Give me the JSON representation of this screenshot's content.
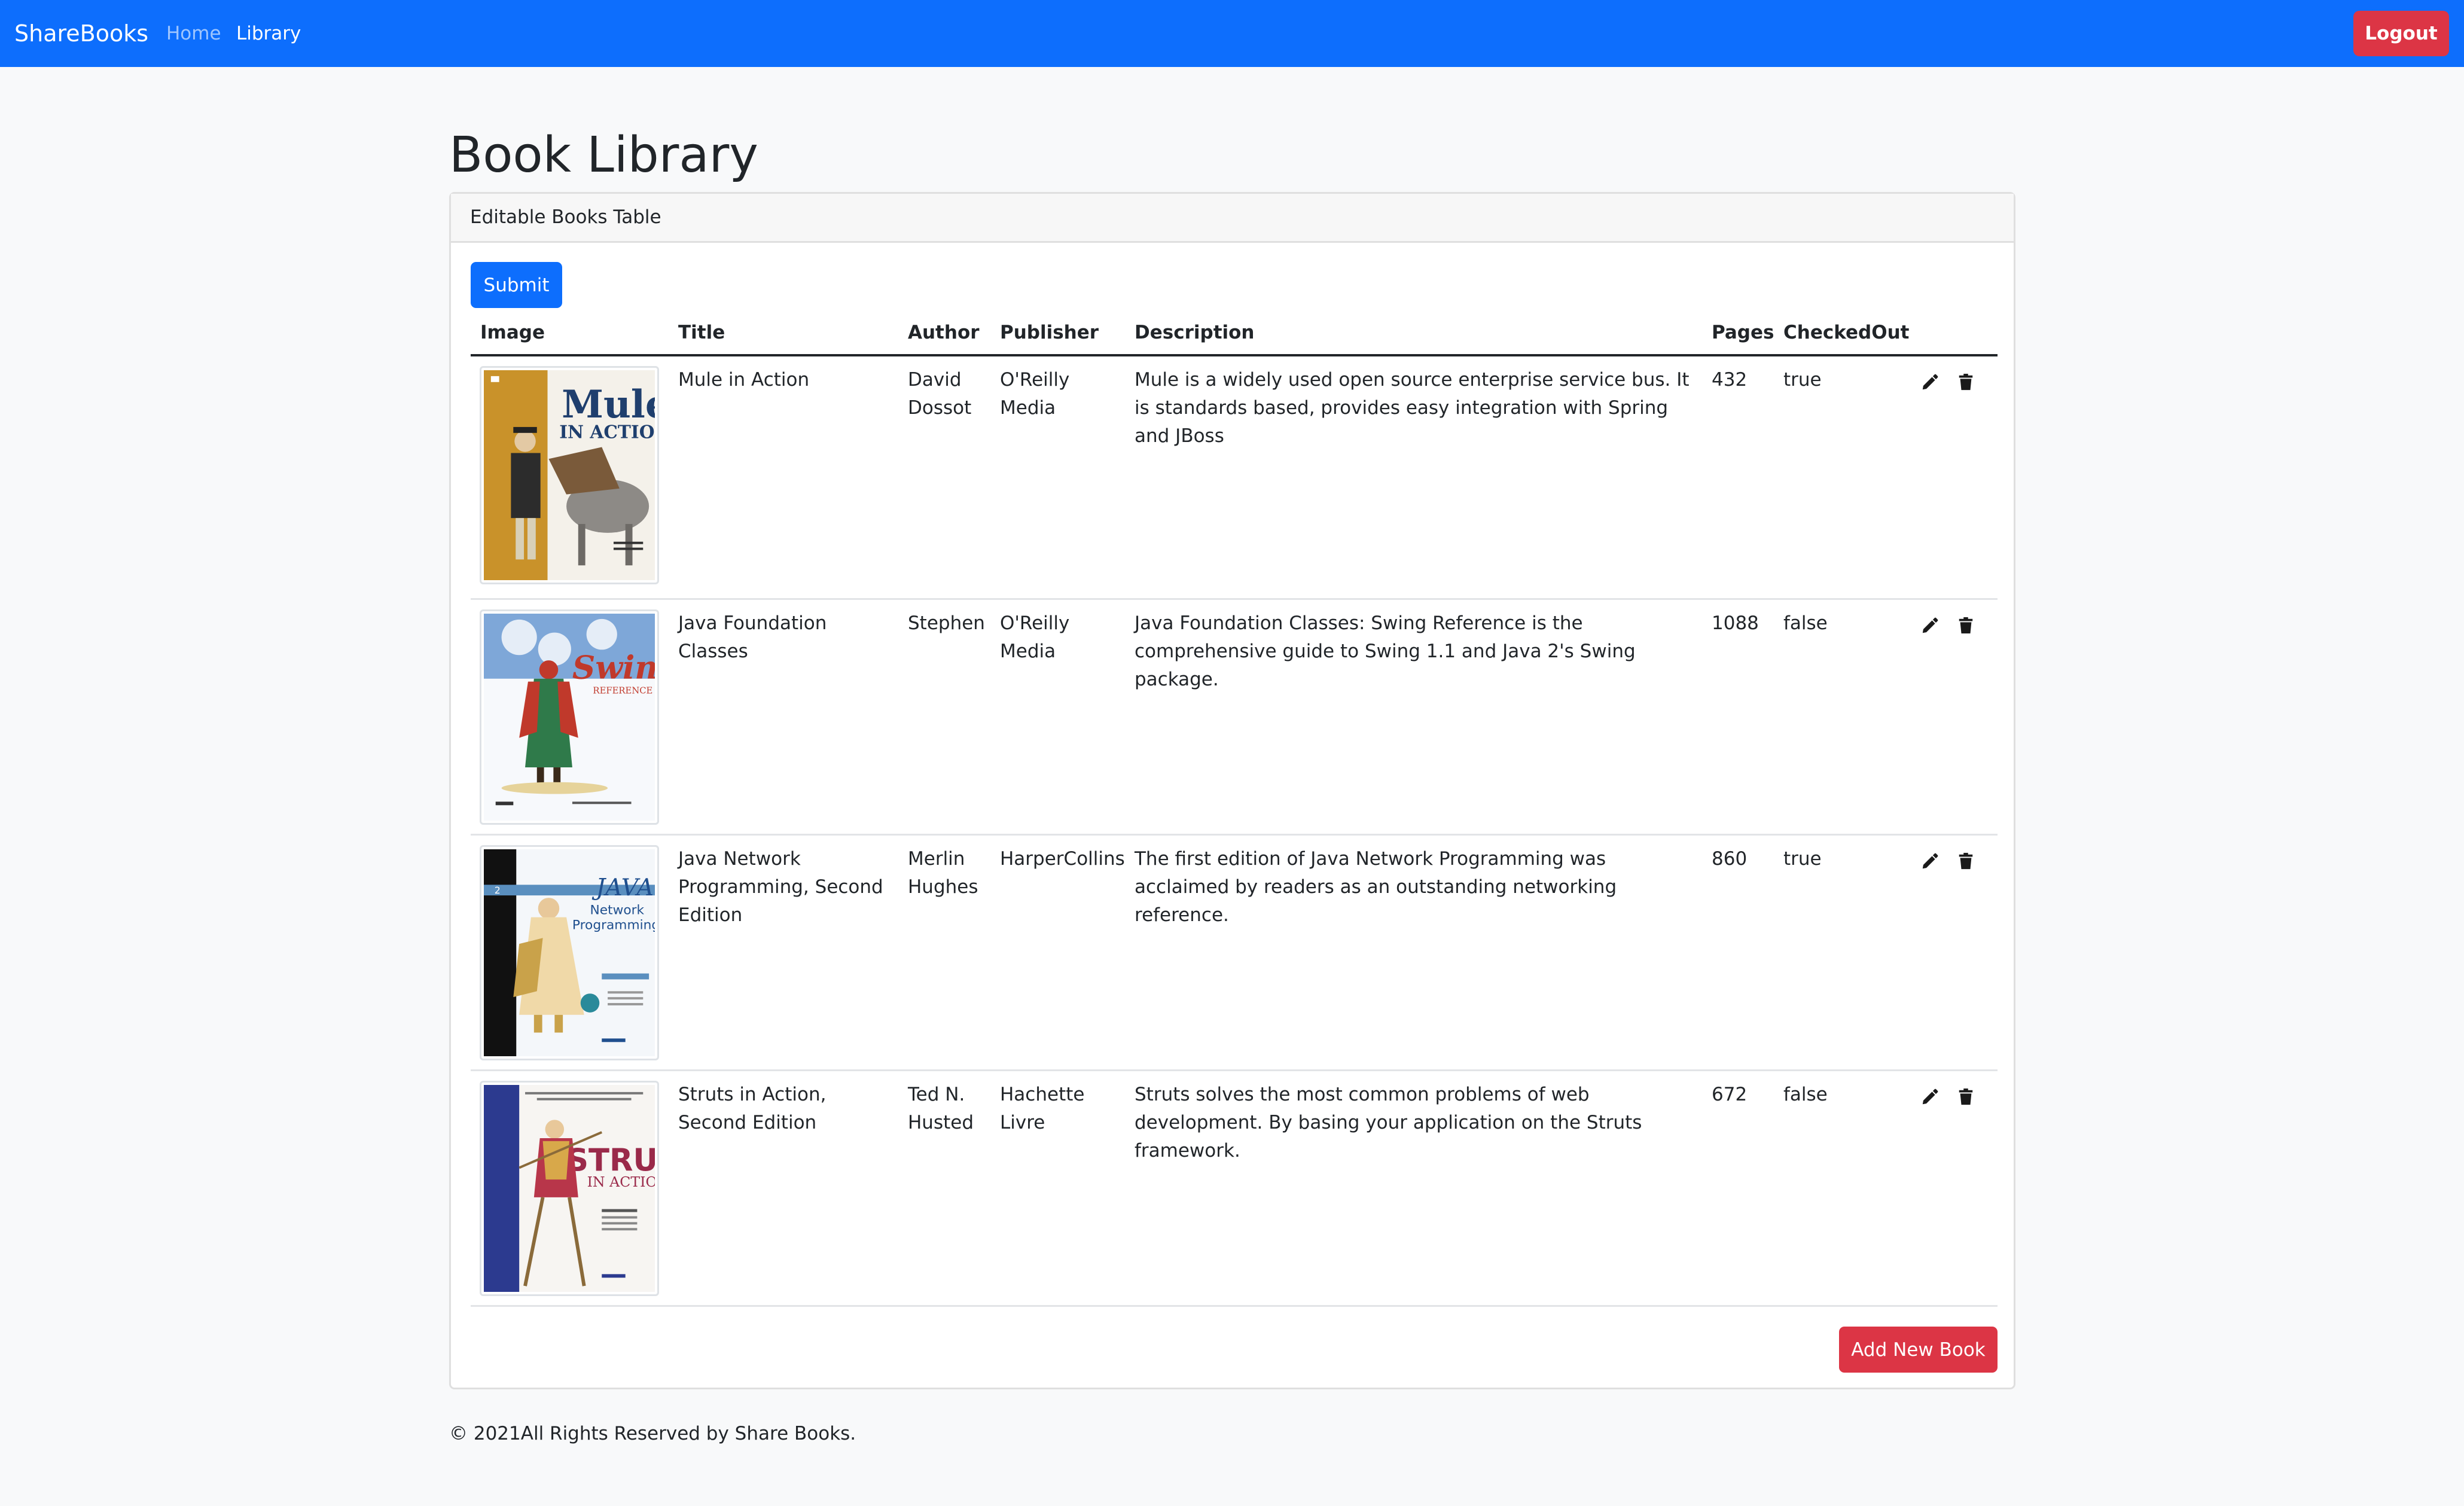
{
  "navbar": {
    "brand": "ShareBooks",
    "links": [
      {
        "label": "Home"
      },
      {
        "label": "Library"
      }
    ],
    "logout_label": "Logout",
    "bg_color": "#0d6efd"
  },
  "page": {
    "title": "Book Library"
  },
  "card": {
    "header": "Editable Books Table",
    "submit_label": "Submit",
    "add_label": "Add New Book"
  },
  "table": {
    "columns": [
      "Image",
      "Title",
      "Author",
      "Publisher",
      "Description",
      "Pages",
      "CheckedOut"
    ],
    "rows": [
      {
        "title": "Mule in Action",
        "author": "David Dossot",
        "publisher": "O'Reilly Media",
        "description": "Mule is a widely used open source enterprise service bus. It is standards based, provides easy integration with Spring and JBoss",
        "pages": "432",
        "checked_out": "true",
        "cover": {
          "line1": "Mule",
          "line2": "IN ACTION"
        }
      },
      {
        "title": "Java Foundation Classes",
        "author": "Stephen",
        "publisher": "O'Reilly Media",
        "description": "Java Foundation Classes: Swing Reference is the comprehensive guide to Swing 1.1 and Java 2's Swing package.",
        "pages": "1088",
        "checked_out": "false",
        "cover": {
          "line1": "Swing",
          "line2": "REFERENCE"
        }
      },
      {
        "title": "Java Network Programming, Second Edition",
        "author": "Merlin Hughes",
        "publisher": "HarperCollins",
        "description": "The first edition of Java Network Programming was acclaimed by readers as an outstanding networking reference.",
        "pages": "860",
        "checked_out": "true",
        "cover": {
          "line1": "JAVA",
          "line2": "Network",
          "line3": "Programming"
        }
      },
      {
        "title": "Struts in Action, Second Edition",
        "author": "Ted N. Husted",
        "publisher": "Hachette Livre",
        "description": "Struts solves the most common problems of web development. By basing your application on the Struts framework.",
        "pages": "672",
        "checked_out": "false",
        "cover": {
          "line1": "STRUTS",
          "line2": "IN ACTION"
        }
      }
    ],
    "icons": [
      "pencil-icon",
      "trash-icon"
    ]
  },
  "footer": {
    "text": "© 2021All Rights Reserved by Share Books."
  }
}
